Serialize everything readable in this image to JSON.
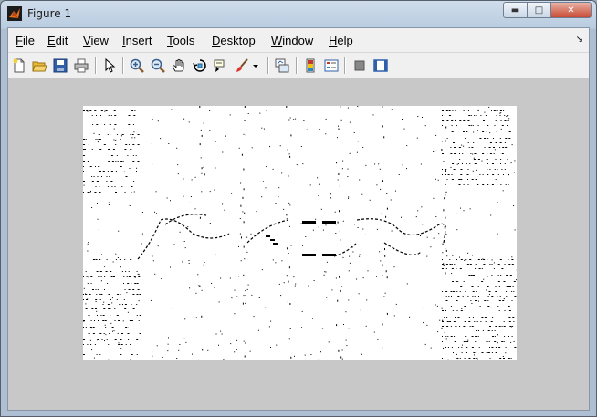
{
  "window": {
    "title": "Figure 1",
    "caption_buttons": {
      "minimize": "▬",
      "maximize": "□",
      "close": "✕"
    }
  },
  "menubar": {
    "items": [
      {
        "label": "File",
        "mnemonic": "F",
        "rest": "ile"
      },
      {
        "label": "Edit",
        "mnemonic": "E",
        "rest": "dit"
      },
      {
        "label": "View",
        "mnemonic": "V",
        "rest": "iew"
      },
      {
        "label": "Insert",
        "mnemonic": "I",
        "rest": "nsert"
      },
      {
        "label": "Tools",
        "mnemonic": "T",
        "rest": "ools"
      },
      {
        "label": "Desktop",
        "mnemonic": "D",
        "rest": "esktop"
      },
      {
        "label": "Window",
        "mnemonic": "W",
        "rest": "indow"
      },
      {
        "label": "Help",
        "mnemonic": "H",
        "rest": "elp"
      }
    ],
    "dock_icon": "dock-arrow-icon"
  },
  "toolbar": {
    "buttons": [
      {
        "icon": "new-figure-icon"
      },
      {
        "icon": "open-file-icon"
      },
      {
        "icon": "save-figure-icon"
      },
      {
        "icon": "print-figure-icon"
      },
      {
        "icon": "edit-plot-arrow-icon"
      },
      {
        "icon": "zoom-in-icon"
      },
      {
        "icon": "zoom-out-icon"
      },
      {
        "icon": "pan-hand-icon"
      },
      {
        "icon": "rotate-3d-icon"
      },
      {
        "icon": "data-cursor-icon"
      },
      {
        "icon": "brush-icon"
      },
      {
        "icon": "link-plot-icon"
      },
      {
        "icon": "insert-colorbar-icon"
      },
      {
        "icon": "insert-legend-icon"
      },
      {
        "icon": "hide-plot-tools-icon"
      },
      {
        "icon": "show-plot-tools-icon"
      }
    ]
  },
  "figure": {
    "content": "binary edge-detected image (black edges on white)",
    "background_color": "#c8c8c8",
    "image_background": "#ffffff",
    "edge_color": "#000000"
  }
}
